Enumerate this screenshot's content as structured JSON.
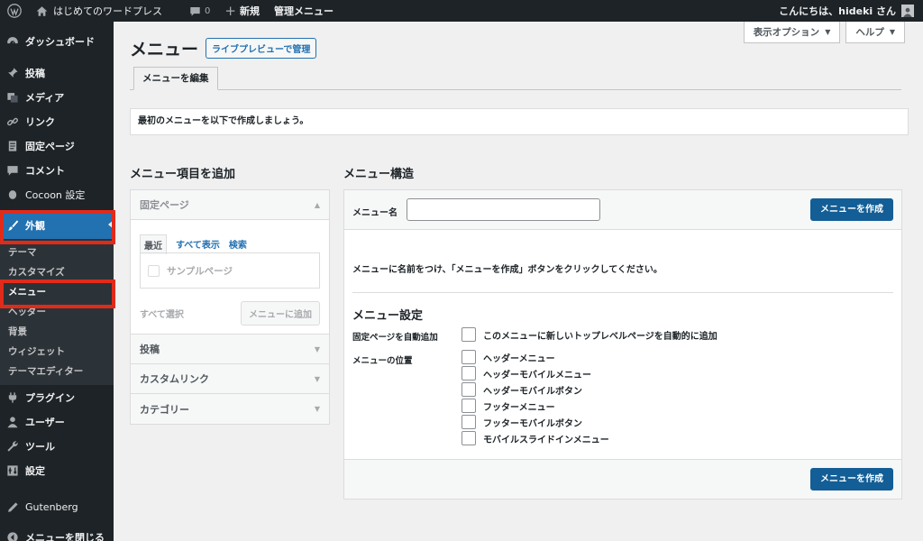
{
  "adminbar": {
    "site_name": "はじめてのワードプレス",
    "comment_count": "0",
    "new_label": "新規",
    "manage_menu_label": "管理メニュー",
    "greeting": "こんにちは、hideki さん"
  },
  "sidebar": {
    "items": [
      {
        "label": "ダッシュボード",
        "icon": "dashboard-icon"
      },
      {
        "label": "投稿",
        "icon": "pin-icon"
      },
      {
        "label": "メディア",
        "icon": "media-icon"
      },
      {
        "label": "リンク",
        "icon": "link-icon"
      },
      {
        "label": "固定ページ",
        "icon": "page-icon"
      },
      {
        "label": "コメント",
        "icon": "comment-icon"
      },
      {
        "label": "Cocoon 設定",
        "icon": "cocoon-icon"
      },
      {
        "label": "外観",
        "icon": "brush-icon"
      },
      {
        "label": "プラグイン",
        "icon": "plugin-icon"
      },
      {
        "label": "ユーザー",
        "icon": "user-icon"
      },
      {
        "label": "ツール",
        "icon": "wrench-icon"
      },
      {
        "label": "設定",
        "icon": "settings-icon"
      },
      {
        "label": "Gutenberg",
        "icon": "gutenberg-icon"
      },
      {
        "label": "メニューを閉じる",
        "icon": "collapse-icon"
      }
    ],
    "submenu": [
      "テーマ",
      "カスタマイズ",
      "メニュー",
      "ヘッダー",
      "背景",
      "ウィジェット",
      "テーマエディター"
    ]
  },
  "header": {
    "screen_options": "表示オプション",
    "help": "ヘルプ",
    "title": "メニュー",
    "live_preview": "ライブプレビューで管理",
    "tab_edit": "メニューを編集",
    "notice": "最初のメニューを以下で作成しましょう。"
  },
  "add_items": {
    "title": "メニュー項目を追加",
    "sections": [
      "固定ページ",
      "投稿",
      "カスタムリンク",
      "カテゴリー"
    ],
    "inner_tabs": [
      "最近",
      "すべて表示",
      "検索"
    ],
    "sample_page": "サンプルページ",
    "select_all": "すべて選択",
    "add_button": "メニューに追加"
  },
  "structure": {
    "title": "メニュー構造",
    "name_label": "メニュー名",
    "name_value": "",
    "create_button": "メニューを作成",
    "message": "メニューに名前をつけ、「メニューを作成」ボタンをクリックしてください。",
    "settings_title": "メニュー設定",
    "auto_add_label": "固定ページを自動追加",
    "auto_add_option": "このメニューに新しいトップレベルページを自動的に追加",
    "location_label": "メニューの位置",
    "locations": [
      "ヘッダーメニュー",
      "ヘッダーモバイルメニュー",
      "ヘッダーモバイルボタン",
      "フッターメニュー",
      "フッターモバイルボタン",
      "モバイルスライドインメニュー"
    ]
  },
  "colors": {
    "admin_dark": "#1d2327",
    "accent": "#2271b1",
    "button_primary": "#135e96",
    "highlight": "#e02b1b"
  }
}
